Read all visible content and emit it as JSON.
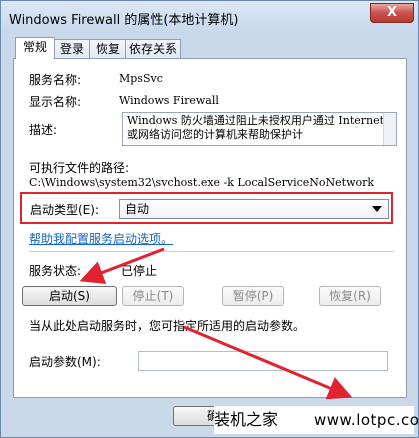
{
  "window": {
    "title": "Windows Firewall 的属性(本地计算机)",
    "close_glyph": "X"
  },
  "tabs": [
    "常规",
    "登录",
    "恢复",
    "依存关系"
  ],
  "general": {
    "service_name_label": "服务名称:",
    "service_name_value": "MpsSvc",
    "display_name_label": "显示名称:",
    "display_name_value": "Windows Firewall",
    "description_label": "描述:",
    "description_value": "Windows 防火墙通过阻止未授权用户通过 Internet 或网络访问您的计算机来帮助保护计",
    "exe_path_label": "可执行文件的路径:",
    "exe_path_value": "C:\\Windows\\system32\\svchost.exe -k LocalServiceNoNetwork",
    "startup_type_label": "启动类型(E):",
    "startup_type_value": "自动",
    "help_link": "帮助我配置服务启动选项。",
    "service_status_label": "服务状态:",
    "service_status_value": "已停止",
    "buttons": {
      "start": "启动(S)",
      "stop": "停止(T)",
      "pause": "暂停(P)",
      "resume": "恢复(R)"
    },
    "start_hint": "当从此处启动服务时，您可指定所适用的启动参数。",
    "start_params_label": "启动参数(M):",
    "start_params_value": ""
  },
  "footer": {
    "ok_partial": "确"
  },
  "watermark": {
    "text": "装机之家",
    "site": "www.lotpc.com"
  },
  "annotation_color": "#e0232e"
}
